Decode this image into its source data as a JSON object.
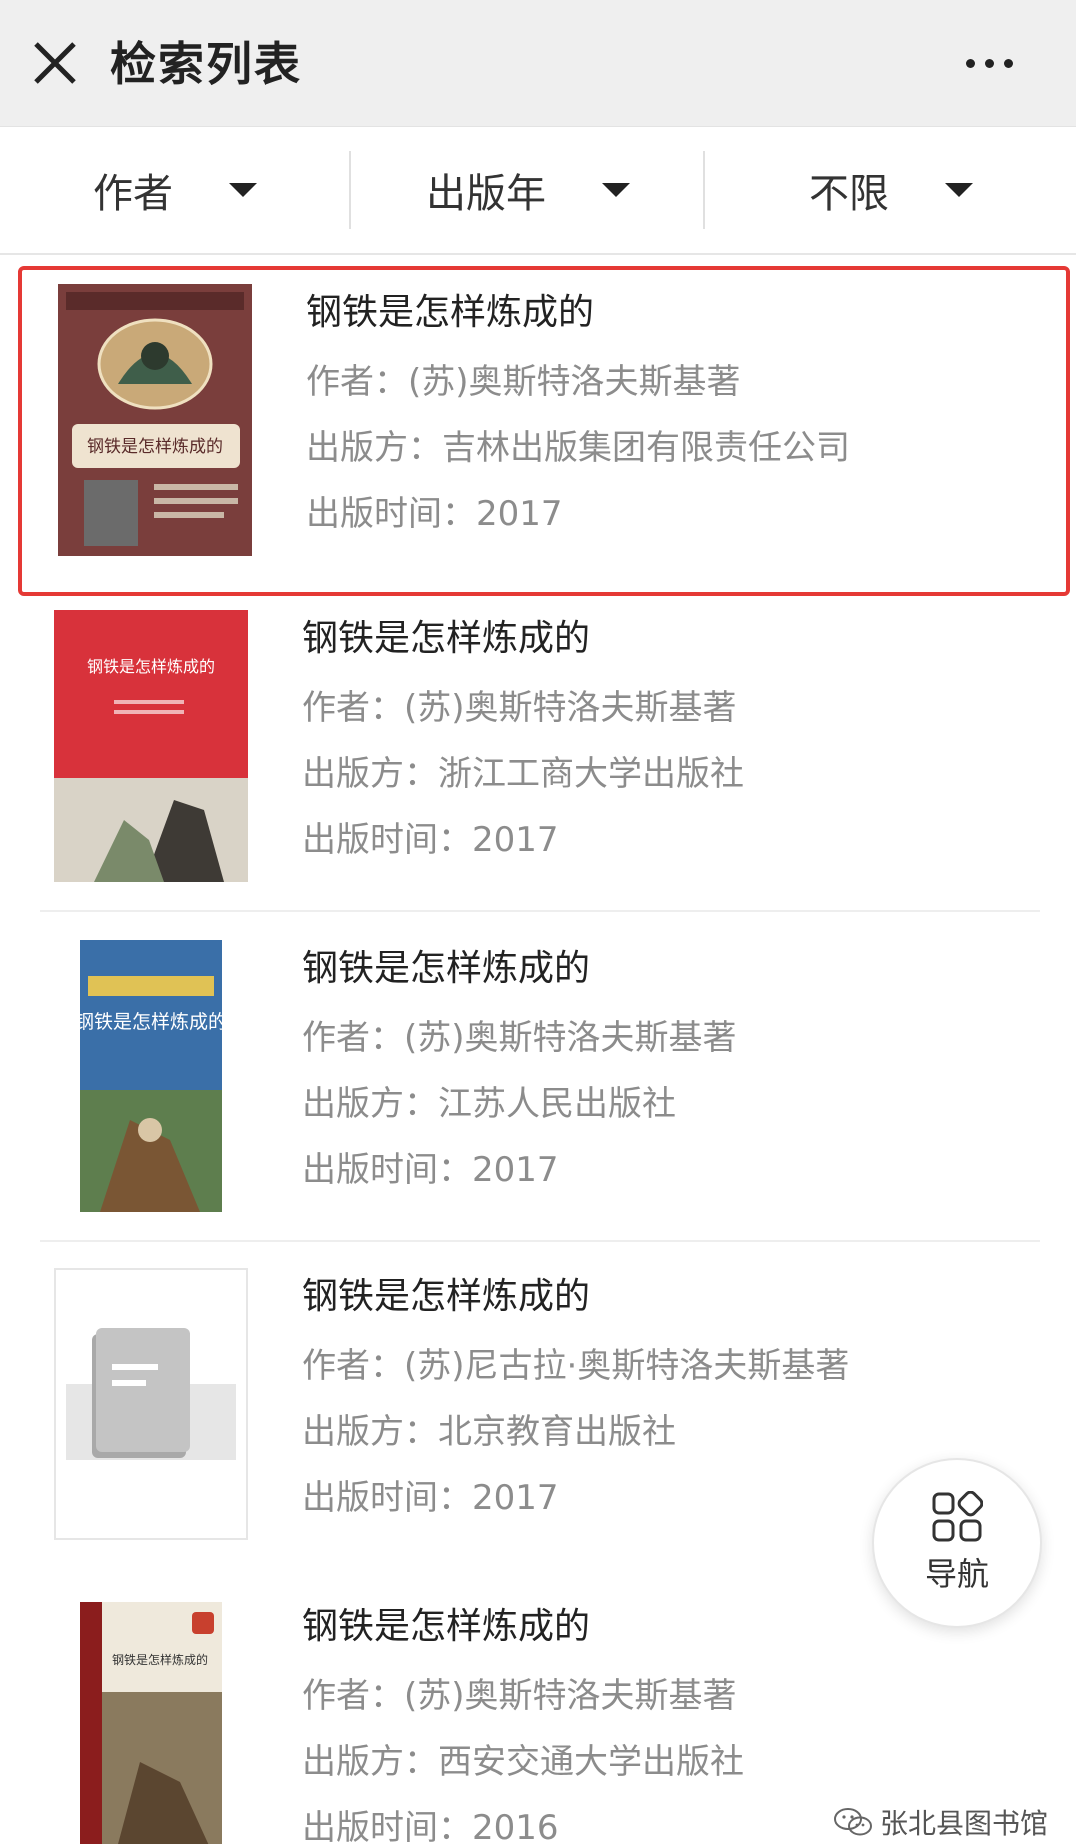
{
  "header": {
    "title": "检索列表"
  },
  "filters": [
    {
      "label": "作者"
    },
    {
      "label": "出版年"
    },
    {
      "label": "不限"
    }
  ],
  "results": [
    {
      "title": "钢铁是怎样炼成的",
      "author": "作者：(苏)奥斯特洛夫斯基著",
      "publisher": "出版方：吉林出版集团有限责任公司",
      "year": "出版时间：2017",
      "cover_text": "钢铁是怎样炼成的",
      "highlighted": true
    },
    {
      "title": "钢铁是怎样炼成的",
      "author": "作者：(苏)奥斯特洛夫斯基著",
      "publisher": "出版方：浙江工商大学出版社",
      "year": "出版时间：2017",
      "cover_text": "钢铁是怎样炼成的"
    },
    {
      "title": "钢铁是怎样炼成的",
      "author": "作者：(苏)奥斯特洛夫斯基著",
      "publisher": "出版方：江苏人民出版社",
      "year": "出版时间：2017",
      "cover_text": "钢铁是怎样炼成的"
    },
    {
      "title": "钢铁是怎样炼成的",
      "author": "作者：(苏)尼古拉·奥斯特洛夫斯基著",
      "publisher": "出版方：北京教育出版社",
      "year": "出版时间：2017"
    },
    {
      "title": "钢铁是怎样炼成的",
      "author": "作者：(苏)奥斯特洛夫斯基著",
      "publisher": "出版方：西安交通大学出版社",
      "year": "出版时间：2016",
      "cover_text": "钢铁是怎样炼成的"
    }
  ],
  "nav_fab": {
    "label": "导航"
  },
  "watermark": {
    "text": "张北县图书馆"
  },
  "colors": {
    "highlight": "#e53935",
    "header_bg": "#efefef",
    "meta_text": "#8c8c8c"
  }
}
